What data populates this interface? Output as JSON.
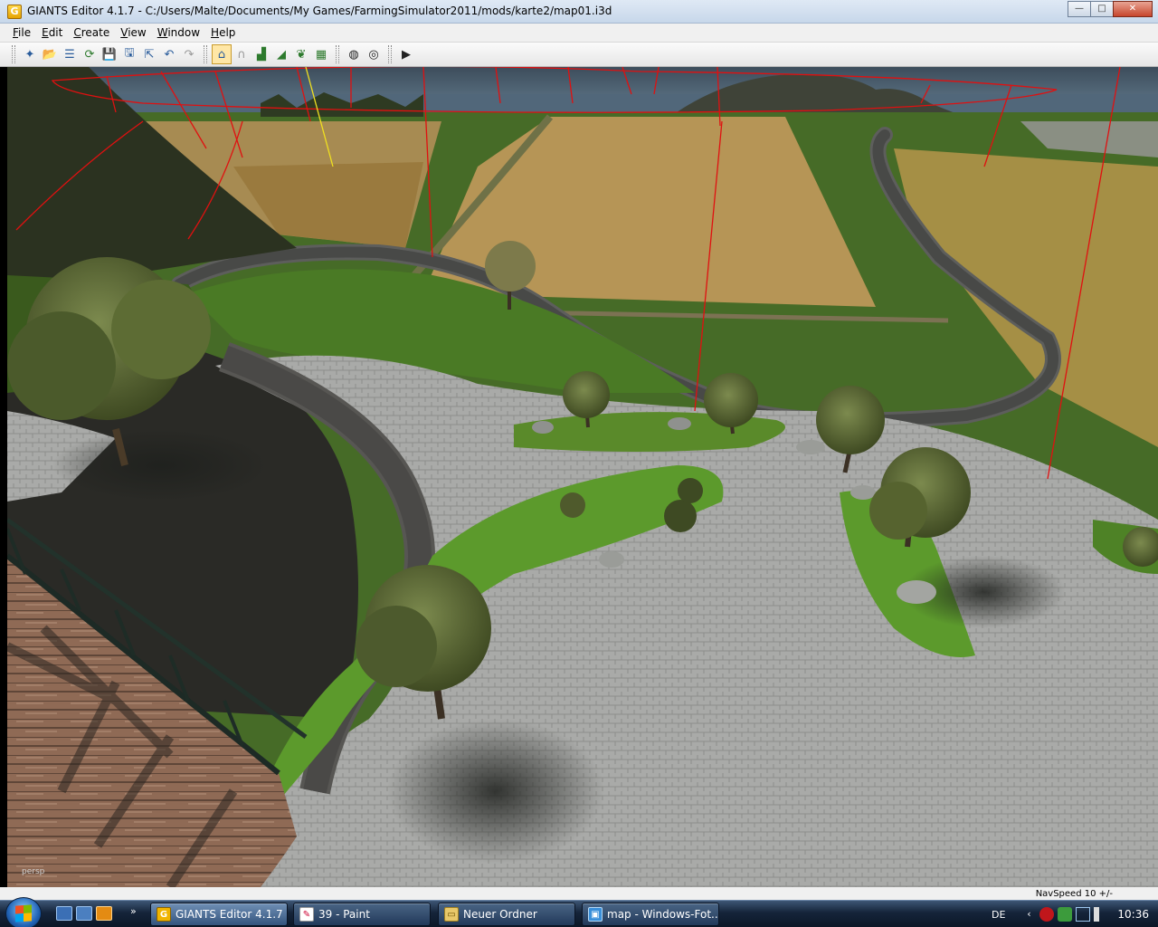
{
  "window": {
    "title": "GIANTS Editor 4.1.7 - C:/Users/Malte/Documents/My Games/FarmingSimulator2011/mods/karte2/map01.i3d",
    "app_icon_letter": "G",
    "minimize_icon": "minimize-icon",
    "maximize_icon": "maximize-icon",
    "close_icon": "close-icon",
    "minimize_glyph": "—",
    "maximize_glyph": "□",
    "close_glyph": "✕"
  },
  "menu": {
    "items": [
      {
        "first": "F",
        "rest": "ile"
      },
      {
        "first": "E",
        "rest": "dit"
      },
      {
        "first": "C",
        "rest": "reate"
      },
      {
        "first": "V",
        "rest": "iew"
      },
      {
        "first": "W",
        "rest": "indow"
      },
      {
        "first": "H",
        "rest": "elp"
      }
    ]
  },
  "toolbar": {
    "new_glyph": "✦",
    "open_glyph": "📂",
    "list_glyph": "☰",
    "reload_glyph": "⟳",
    "save_glyph": "💾",
    "save_all_glyph": "🖫",
    "export_glyph": "⇱",
    "undo_glyph": "↶",
    "redo_glyph": "↷",
    "select_glyph": "⌂",
    "magnet_glyph": "∩",
    "terrain_glyph": "▟",
    "terrain_paint_glyph": "◢",
    "foliage_glyph": "❦",
    "terrain_info_glyph": "▦",
    "grid_glyph": "◍",
    "grid2_glyph": "◎",
    "play_glyph": "▶"
  },
  "viewport": {
    "camera_label": "persp",
    "sky_color": "#5a6f80",
    "grass_color": "#3f6a22",
    "cobble_color": "#a7a8a6",
    "road_color": "#4d4d4d",
    "field_color": "#b89a4d",
    "guide_line_color": "#e01010"
  },
  "status": {
    "navspeed": "NavSpeed 10 +/-"
  },
  "taskbar": {
    "tasks": [
      {
        "label": "GIANTS Editor 4.1.7 ...",
        "icon": "G"
      },
      {
        "label": "39 - Paint",
        "icon": "✎"
      },
      {
        "label": "Neuer Ordner",
        "icon": "▭"
      },
      {
        "label": "map - Windows-Fot...",
        "icon": "▣"
      }
    ],
    "more_glyph": "»",
    "language": "DE",
    "tray_arrow": "‹",
    "clock": "10:36"
  }
}
